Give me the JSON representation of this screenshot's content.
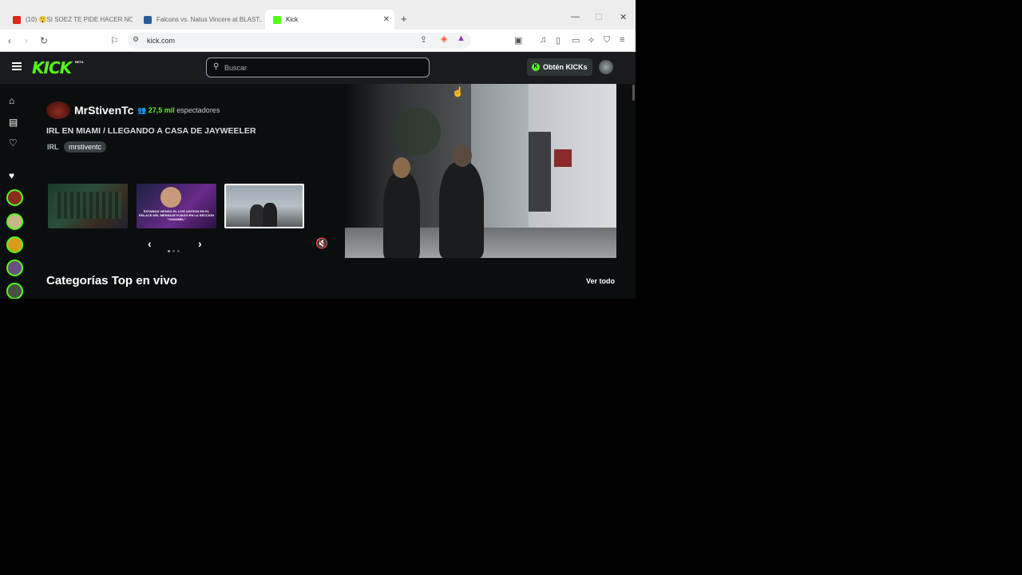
{
  "browser": {
    "tabs": [
      {
        "label": "(10) 😲SI SOEZ TE PIDE HACER NOV"
      },
      {
        "label": "Falcons vs. Natus Vincere at BLAST..."
      },
      {
        "label": "Kick"
      }
    ],
    "url": "kick.com"
  },
  "header": {
    "logo": "KICK",
    "beta": "BETA",
    "search_placeholder": "Buscar",
    "kicks_label": "Obtén KICKs",
    "kicks_icon": "K"
  },
  "featured": {
    "streamer": "MrStivenTc",
    "viewers_count": "27,5 mil",
    "viewers_label": "espectadores",
    "title": "IRL EN MIAMI / LLEGANDO A CASA DE JAYWEELER",
    "category": "IRL",
    "tag": "mrstiventc",
    "thumb_caption": "ESTAMOS VIENDO EL LIVE ADITION EN EL ENLACE DEL MENSAJE FIJADO EN LA SECCION \"CHANNEL\""
  },
  "section": {
    "title": "Categorías Top en vivo",
    "see_all": "Ver todo"
  },
  "colors": {
    "brand_green": "#53fc18",
    "header_bg": "#191b1f",
    "page_bg": "#0b0e0f"
  },
  "icons": [
    "home-icon",
    "browse-icon",
    "heart-outline-icon",
    "heart-icon",
    "search-icon",
    "mute-icon",
    "chevron-left-icon",
    "chevron-right-icon"
  ]
}
